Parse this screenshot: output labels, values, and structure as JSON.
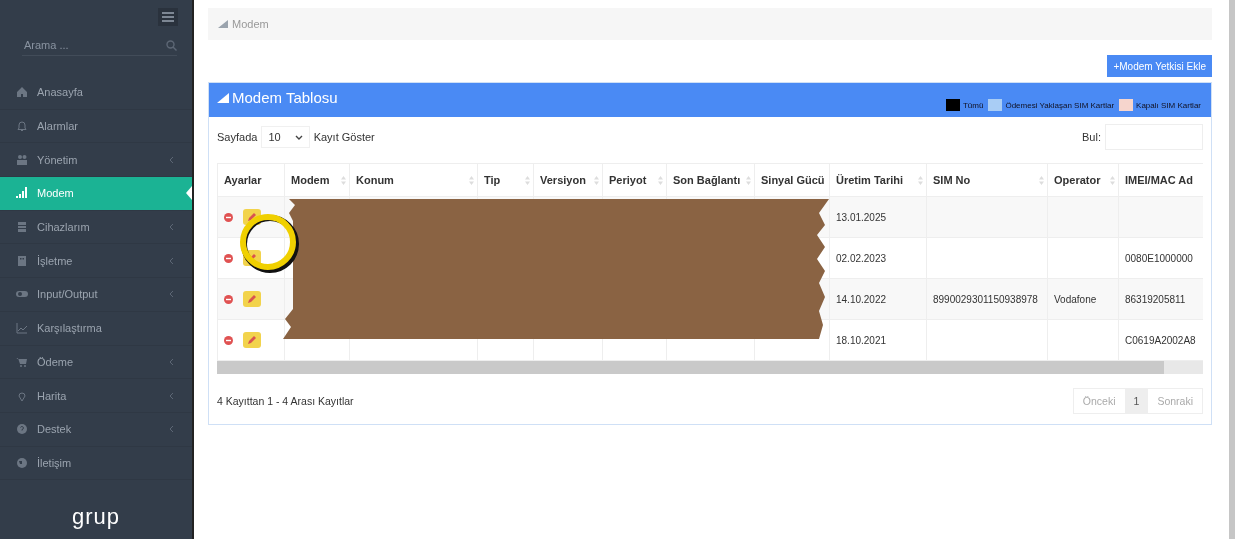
{
  "sidebar": {
    "search": {
      "placeholder": "Arama ..."
    },
    "items": [
      {
        "label": "Anasayfa",
        "selected": false,
        "expandable": false
      },
      {
        "label": "Alarmlar",
        "selected": false,
        "expandable": false
      },
      {
        "label": "Yönetim",
        "selected": false,
        "expandable": true
      },
      {
        "label": "Modem",
        "selected": true,
        "expandable": false
      },
      {
        "label": "Cihazlarım",
        "selected": false,
        "expandable": true
      },
      {
        "label": "İşletme",
        "selected": false,
        "expandable": true
      },
      {
        "label": "Input/Output",
        "selected": false,
        "expandable": true
      },
      {
        "label": "Karşılaştırma",
        "selected": false,
        "expandable": false
      },
      {
        "label": "Ödeme",
        "selected": false,
        "expandable": true
      },
      {
        "label": "Harita",
        "selected": false,
        "expandable": true
      },
      {
        "label": "Destek",
        "selected": false,
        "expandable": true
      },
      {
        "label": "İletişim",
        "selected": false,
        "expandable": false
      }
    ],
    "logo": "grup"
  },
  "breadcrumb": "Modem",
  "add_button": "+Modem Yetkisi Ekle",
  "panel": {
    "title": "Modem Tablosu",
    "legend": [
      {
        "label": "Tümü",
        "color": "#000000"
      },
      {
        "label": "Ödemesi Yaklaşan SIM Kartlar",
        "color": "#a9cdf5"
      },
      {
        "label": "Kapalı SIM Kartlar",
        "color": "#f6d5cd"
      }
    ],
    "page_size_label": "Sayfada",
    "page_size": "10",
    "page_size_suffix": "Kayıt Göster",
    "search_label": "Bul:",
    "columns": [
      {
        "label": "Ayarlar",
        "sortable": false
      },
      {
        "label": "Modem",
        "sortable": true
      },
      {
        "label": "Konum",
        "sortable": true
      },
      {
        "label": "Tip",
        "sortable": true
      },
      {
        "label": "Versiyon",
        "sortable": true
      },
      {
        "label": "Periyot",
        "sortable": true
      },
      {
        "label": "Son Bağlantı",
        "sortable": true
      },
      {
        "label": "Sinyal Gücü",
        "sortable": false
      },
      {
        "label": "Üretim Tarihi",
        "sortable": true
      },
      {
        "label": "SIM No",
        "sortable": true
      },
      {
        "label": "Operator",
        "sortable": true
      },
      {
        "label": "IMEI/MAC Ad",
        "sortable": false
      }
    ],
    "rows": [
      {
        "production_date": "13.01.2025"
      },
      {
        "production_date": "02.02.2023",
        "imei": "0080E1000000"
      },
      {
        "production_date": "14.10.2022",
        "sim_no": "8990029301150938978",
        "operator": "Vodafone",
        "imei": "86319205811"
      },
      {
        "production_date": "18.10.2021",
        "imei": "C0619A2002A8"
      }
    ],
    "info": "4 Kayıttan 1 - 4 Arası Kayıtlar",
    "pagination": [
      {
        "label": "Önceki",
        "selected": false,
        "disabled": true
      },
      {
        "label": "1",
        "selected": true,
        "disabled": false
      },
      {
        "label": "Sonraki",
        "selected": false,
        "disabled": true
      }
    ]
  }
}
